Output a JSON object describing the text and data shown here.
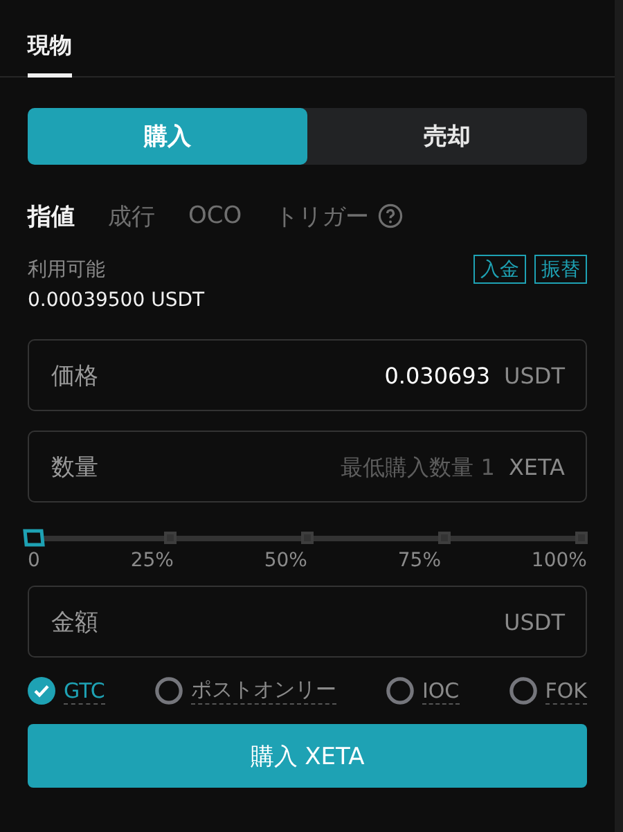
{
  "tabs": [
    {
      "label": "現物",
      "selected": true
    }
  ],
  "side_toggle": [
    {
      "label": "購入",
      "selected": true
    },
    {
      "label": "売却",
      "selected": false
    }
  ],
  "order_types": [
    {
      "label": "指値",
      "selected": true,
      "has_help": false
    },
    {
      "label": "成行",
      "selected": false,
      "has_help": false
    },
    {
      "label": "OCO",
      "selected": false,
      "has_help": false
    },
    {
      "label": "トリガー",
      "selected": false,
      "has_help": true
    }
  ],
  "available": {
    "label": "利用可能",
    "value": "0.00039500 USDT",
    "actions": [
      "入金",
      "振替"
    ]
  },
  "fields": [
    {
      "label": "価格",
      "value": "0.030693",
      "unit": "USDT"
    },
    {
      "label": "数量",
      "placeholder": "最低購入数量 1",
      "unit": "XETA"
    },
    {
      "label": "金額",
      "unit": "USDT"
    }
  ],
  "slider": {
    "level": 0,
    "ticks": [
      "0",
      "25%",
      "50%",
      "75%",
      "100%"
    ]
  },
  "time_in_force": [
    {
      "label": "GTC",
      "selected": true
    },
    {
      "label": "ポストオンリー",
      "selected": false
    },
    {
      "label": "IOC",
      "selected": false
    },
    {
      "label": "FOK",
      "selected": false
    }
  ],
  "submit": "購入 XETA"
}
